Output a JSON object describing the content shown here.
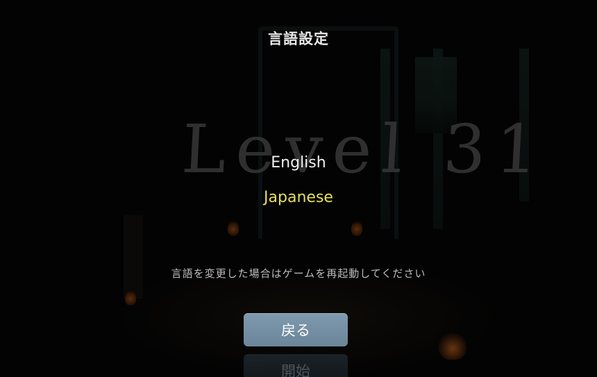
{
  "screen": {
    "title": "言語設定",
    "logo_text": "Level 31",
    "languages": [
      {
        "label": "English",
        "selected": false
      },
      {
        "label": "Japanese",
        "selected": true
      }
    ],
    "notice": "言語を変更した場合はゲームを再起動してください",
    "back_button_label": "戻る",
    "start_button_label": "開始"
  },
  "colors": {
    "selected_language": "#e6e05a",
    "unselected_language": "#f0f0f0",
    "button_fill": "#7590a4"
  }
}
